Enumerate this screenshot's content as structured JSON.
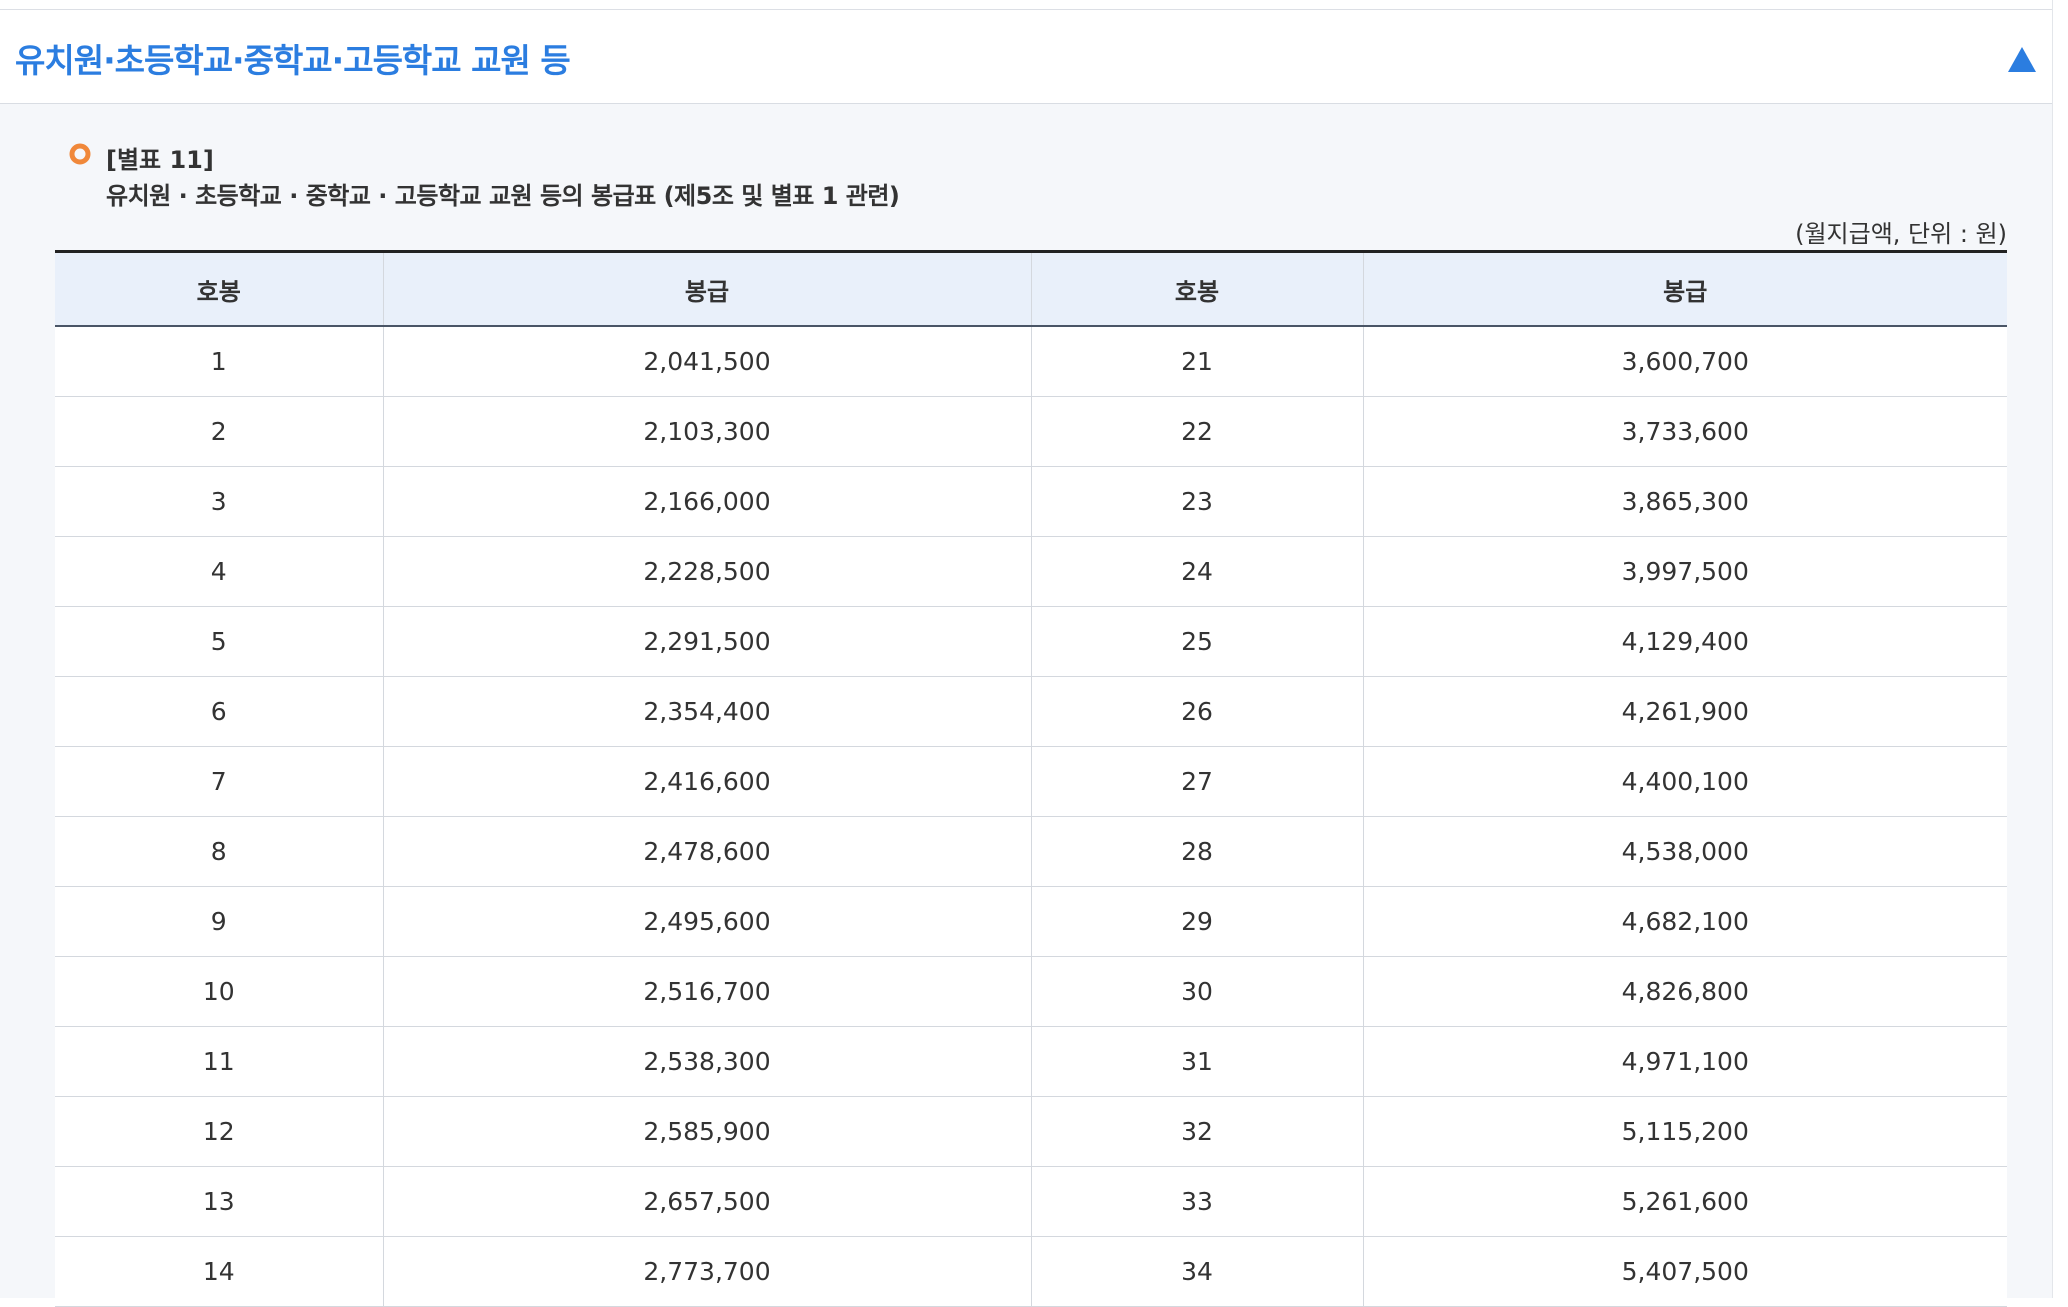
{
  "accordion": {
    "title": "유치원·초등학교·중학교·고등학교 교원 등",
    "toggle_icon": "triangle-up-icon",
    "accent_color": "#2b7de0"
  },
  "table_info": {
    "number": "[별표 11]",
    "caption": "유치원 · 초등학교 · 중학교 · 고등학교 교원 등의 봉급표 (제5조 및 별표 1 관련)",
    "unit_note": "(월지급액, 단위 : 원)",
    "bullet_icon": "circle-bullet-icon",
    "bullet_color": "#f0883a"
  },
  "headers": [
    "호봉",
    "봉급",
    "호봉",
    "봉급"
  ],
  "rows": [
    [
      "1",
      "2,041,500",
      "21",
      "3,600,700"
    ],
    [
      "2",
      "2,103,300",
      "22",
      "3,733,600"
    ],
    [
      "3",
      "2,166,000",
      "23",
      "3,865,300"
    ],
    [
      "4",
      "2,228,500",
      "24",
      "3,997,500"
    ],
    [
      "5",
      "2,291,500",
      "25",
      "4,129,400"
    ],
    [
      "6",
      "2,354,400",
      "26",
      "4,261,900"
    ],
    [
      "7",
      "2,416,600",
      "27",
      "4,400,100"
    ],
    [
      "8",
      "2,478,600",
      "28",
      "4,538,000"
    ],
    [
      "9",
      "2,495,600",
      "29",
      "4,682,100"
    ],
    [
      "10",
      "2,516,700",
      "30",
      "4,826,800"
    ],
    [
      "11",
      "2,538,300",
      "31",
      "4,971,100"
    ],
    [
      "12",
      "2,585,900",
      "32",
      "5,115,200"
    ],
    [
      "13",
      "2,657,500",
      "33",
      "5,261,600"
    ],
    [
      "14",
      "2,773,700",
      "34",
      "5,407,500"
    ]
  ]
}
